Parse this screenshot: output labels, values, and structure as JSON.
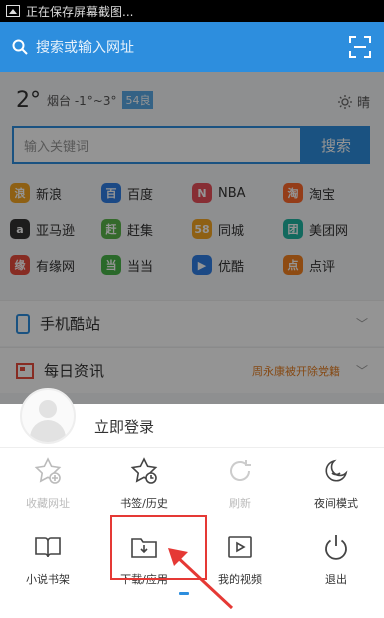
{
  "status_bar": {
    "text": "正在保存屏幕截图..."
  },
  "top_bar": {
    "search_placeholder": "搜索或输入网址"
  },
  "weather": {
    "temp": "2°",
    "city_range": "烟台 -1°~3°",
    "aqi": "54良",
    "condition": "晴"
  },
  "keyword": {
    "placeholder": "输入关键词",
    "button": "搜索"
  },
  "links": [
    {
      "label": "新浪",
      "icon": "weibo-icon",
      "color": "#f5a623",
      "glyph": "浪"
    },
    {
      "label": "百度",
      "icon": "baidu-paw-icon",
      "color": "#2f7ee6",
      "glyph": "百"
    },
    {
      "label": "NBA",
      "icon": "nba-icon",
      "color": "#e8505b",
      "glyph": "N"
    },
    {
      "label": "淘宝",
      "icon": "taobao-icon",
      "color": "#ff6a2c",
      "glyph": "淘"
    },
    {
      "label": "亚马逊",
      "icon": "amazon-icon",
      "color": "#333333",
      "glyph": "a"
    },
    {
      "label": "赶集",
      "icon": "ganji-icon",
      "color": "#5ab64a",
      "glyph": "赶"
    },
    {
      "label": "同城",
      "icon": "58-icon",
      "color": "#f5a623",
      "glyph": "58"
    },
    {
      "label": "美团网",
      "icon": "meituan-icon",
      "color": "#1fb5a2",
      "glyph": "团"
    },
    {
      "label": "有缘网",
      "icon": "youyuan-icon",
      "color": "#e84c3d",
      "glyph": "缘"
    },
    {
      "label": "当当",
      "icon": "dangdang-icon",
      "color": "#49b649",
      "glyph": "当"
    },
    {
      "label": "优酷",
      "icon": "youku-icon",
      "color": "#2f7ee6",
      "glyph": "▶"
    },
    {
      "label": "点评",
      "icon": "dianping-icon",
      "color": "#f58220",
      "glyph": "点"
    }
  ],
  "sections": {
    "mobile": "手机酷站",
    "news": "每日资讯",
    "news_note": "周永康被开除党籍"
  },
  "sheet": {
    "login": "立即登录",
    "items": [
      {
        "label": "收藏网址",
        "icon": "star-add-icon",
        "enabled": false
      },
      {
        "label": "书签/历史",
        "icon": "star-clock-icon",
        "enabled": true
      },
      {
        "label": "刷新",
        "icon": "refresh-icon",
        "enabled": false
      },
      {
        "label": "夜间模式",
        "icon": "moon-icon",
        "enabled": true
      },
      {
        "label": "小说书架",
        "icon": "book-icon",
        "enabled": true
      },
      {
        "label": "下载/应用",
        "icon": "download-folder-icon",
        "enabled": true
      },
      {
        "label": "我的视频",
        "icon": "video-icon",
        "enabled": true
      },
      {
        "label": "退出",
        "icon": "power-icon",
        "enabled": true
      }
    ]
  },
  "colors": {
    "accent": "#2d8ede",
    "highlight": "#e53935"
  }
}
